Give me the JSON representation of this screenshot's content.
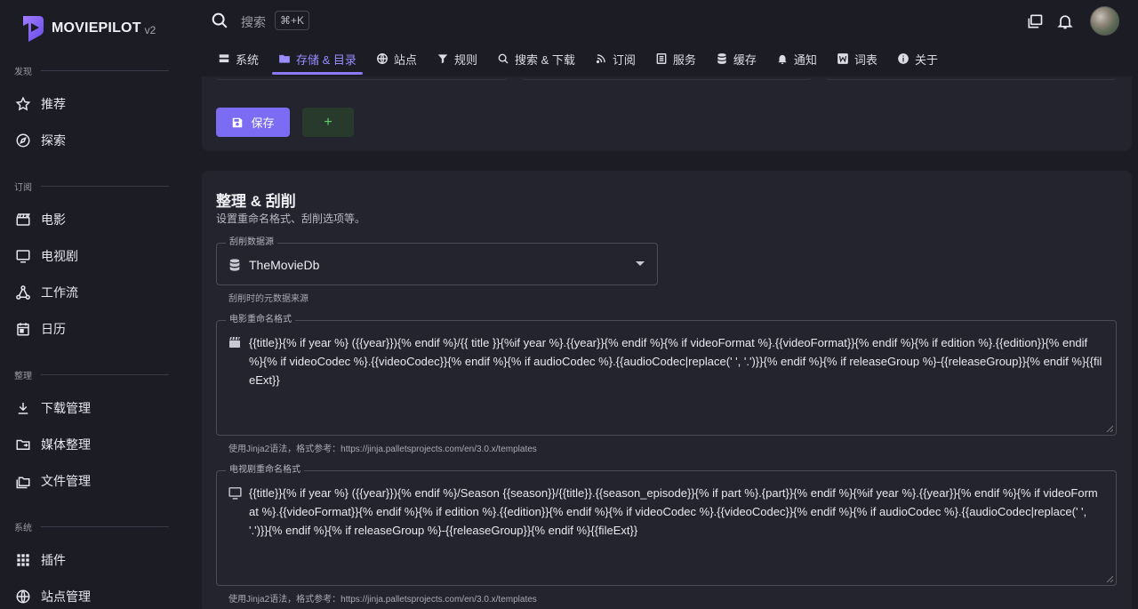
{
  "app": {
    "name": "MOVIEPILOT",
    "version": "v2"
  },
  "sidebar": {
    "sections": [
      {
        "title": "发现",
        "items": [
          {
            "label": "推荐",
            "icon": "star-icon"
          },
          {
            "label": "探索",
            "icon": "compass-icon"
          }
        ]
      },
      {
        "title": "订阅",
        "items": [
          {
            "label": "电影",
            "icon": "clapperboard-icon"
          },
          {
            "label": "电视剧",
            "icon": "monitor-icon"
          },
          {
            "label": "工作流",
            "icon": "workflow-icon"
          },
          {
            "label": "日历",
            "icon": "calendar-icon"
          }
        ]
      },
      {
        "title": "整理",
        "items": [
          {
            "label": "下载管理",
            "icon": "download-icon"
          },
          {
            "label": "媒体整理",
            "icon": "folder-move-icon"
          },
          {
            "label": "文件管理",
            "icon": "folders-icon"
          }
        ]
      },
      {
        "title": "系统",
        "items": [
          {
            "label": "插件",
            "icon": "grid-icon"
          },
          {
            "label": "站点管理",
            "icon": "globe-icon"
          }
        ]
      }
    ]
  },
  "topbar": {
    "search_placeholder": "搜索",
    "shortcut": "⌘+K"
  },
  "tabs": [
    {
      "label": "系统",
      "icon": "server-icon",
      "active": false
    },
    {
      "label": "存储 & 目录",
      "icon": "folder-icon",
      "active": true
    },
    {
      "label": "站点",
      "icon": "globe-icon",
      "active": false
    },
    {
      "label": "规则",
      "icon": "filter-icon",
      "active": false
    },
    {
      "label": "搜索 & 下载",
      "icon": "search-icon",
      "active": false
    },
    {
      "label": "订阅",
      "icon": "rss-icon",
      "active": false
    },
    {
      "label": "服务",
      "icon": "list-icon",
      "active": false
    },
    {
      "label": "缓存",
      "icon": "database-icon",
      "active": false
    },
    {
      "label": "通知",
      "icon": "bell-icon",
      "active": false
    },
    {
      "label": "词表",
      "icon": "word-icon",
      "active": false
    },
    {
      "label": "关于",
      "icon": "info-icon",
      "active": false
    }
  ],
  "storage_card": {
    "save_label": "保存",
    "add_label": "+"
  },
  "organize_card": {
    "title": "整理 & 刮削",
    "subtitle": "设置重命名格式、刮削选项等。",
    "scrape_source": {
      "label": "刮削数据源",
      "value": "TheMovieDb",
      "hint": "刮削时的元数据来源"
    },
    "movie_format": {
      "label": "电影重命名格式",
      "value": "{{title}}{% if year %} ({{year}}){% endif %}/{{ title }}{%if year %}.{{year}}{% endif %}{% if videoFormat %}.{{videoFormat}}{% endif %}{% if edition %}.{{edition}}{% endif %}{% if videoCodec %}.{{videoCodec}}{% endif %}{% if audioCodec %}.{{audioCodec|replace(' ', '.')}}{% endif %}{% if releaseGroup %}-{{releaseGroup}}{% endif %}{{fileExt}}",
      "hint": "使用Jinja2语法，格式参考：https://jinja.palletsprojects.com/en/3.0.x/templates"
    },
    "tv_format": {
      "label": "电视剧重命名格式",
      "value": "{{title}}{% if year %} ({{year}}){% endif %}/Season {{season}}/{{title}}.{{season_episode}}{% if part %}.{part}}{% endif %}{%if year %}.{{year}}{% endif %}{% if videoFormat %}.{{videoFormat}}{% endif %}{% if edition %}.{{edition}}{% endif %}{% if videoCodec %}.{{videoCodec}}{% endif %}{% if audioCodec %}.{{audioCodec|replace(' ', '.')}}{% endif %}{% if releaseGroup %}-{{releaseGroup}}{% endif %}{{fileExt}}",
      "hint": "使用Jinja2语法，格式参考：https://jinja.palletsprojects.com/en/3.0.x/templates"
    }
  },
  "colors": {
    "accent": "#7b6cf3",
    "background": "#1b1c24",
    "card": "#23242e",
    "add_button": "#283a2b"
  }
}
